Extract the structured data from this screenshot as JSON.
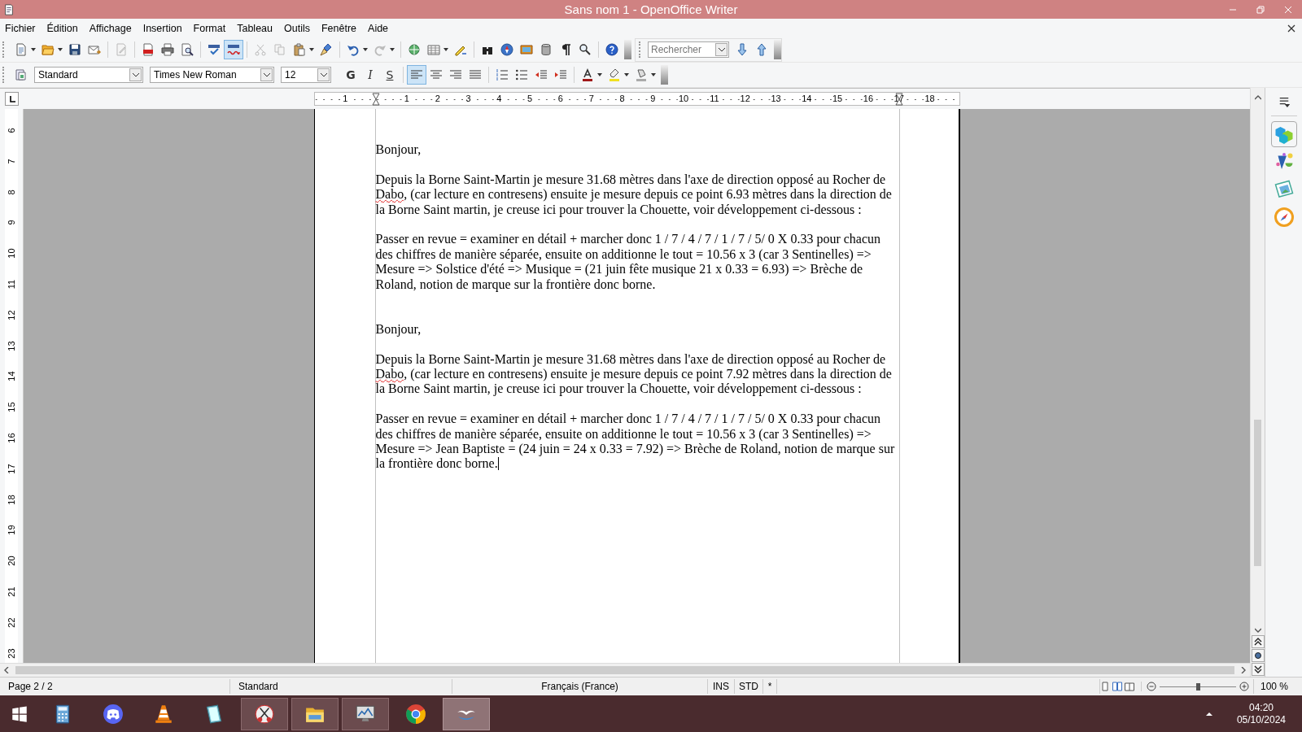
{
  "window": {
    "title": "Sans nom 1 - OpenOffice Writer"
  },
  "menu": [
    {
      "label": "Fichier"
    },
    {
      "label": "Édition"
    },
    {
      "label": "Affichage"
    },
    {
      "label": "Insertion"
    },
    {
      "label": "Format"
    },
    {
      "label": "Tableau"
    },
    {
      "label": "Outils"
    },
    {
      "label": "Fenêtre"
    },
    {
      "label": "Aide"
    }
  ],
  "standard_toolbar": {
    "autospell": {
      "on": true
    },
    "search": {
      "placeholder": "Rechercher"
    }
  },
  "formatting_toolbar": {
    "paragraph_style": "Standard",
    "font_name": "Times New Roman",
    "font_size": "12",
    "text_style_buttons": [
      "G",
      "I",
      "S"
    ],
    "alignment": [
      {
        "selected": true
      },
      {
        "selected": false
      },
      {
        "selected": false
      },
      {
        "selected": false
      }
    ]
  },
  "ruler": {
    "negative_labels": [
      "1"
    ],
    "labels": [
      "1",
      "2",
      "3",
      "4",
      "5",
      "6",
      "7",
      "8",
      "9",
      "10",
      "11",
      "12",
      "13",
      "14",
      "15",
      "16",
      "17",
      "18"
    ],
    "vertical_labels": [
      "6",
      "7",
      "8",
      "9",
      "10",
      "11",
      "12",
      "13",
      "14",
      "15",
      "16",
      "17",
      "18",
      "19",
      "20",
      "21",
      "22",
      "23"
    ]
  },
  "document": {
    "paragraphs": [
      {
        "kind": "text",
        "segments": [
          {
            "text": "Bonjour,",
            "misspelled": false
          }
        ]
      },
      {
        "kind": "blank"
      },
      {
        "kind": "text",
        "segments": [
          {
            "text": "Depuis la Borne Saint-Martin je mesure 31.68 mètres dans l'axe de direction opposé au Rocher de ",
            "misspelled": false
          },
          {
            "text": "Dabo",
            "misspelled": true
          },
          {
            "text": ", (car lecture en contresens) ensuite je mesure depuis ce point 6.93 mètres dans la direction de la Borne Saint martin, je creuse ici pour trouver la Chouette, voir développement ci-dessous :",
            "misspelled": false
          }
        ]
      },
      {
        "kind": "blank"
      },
      {
        "kind": "text",
        "segments": [
          {
            "text": "Passer en revue = examiner en détail + marcher donc 1 / 7 / 4 / 7 / 1 / 7 / 5/ 0 X 0.33 pour chacun des chiffres de manière séparée, ensuite on additionne le tout = 10.56 x 3 (car 3 Sentinelles) => Mesure => Solstice d'été => Musique = (21 juin fête musique 21 x 0.33 = 6.93) => Brèche de Roland, notion de marque sur la frontière donc borne.",
            "misspelled": false
          }
        ]
      },
      {
        "kind": "blank"
      },
      {
        "kind": "blank"
      },
      {
        "kind": "text",
        "segments": [
          {
            "text": "Bonjour,",
            "misspelled": false
          }
        ]
      },
      {
        "kind": "blank"
      },
      {
        "kind": "text",
        "segments": [
          {
            "text": "Depuis la Borne Saint-Martin je mesure 31.68 mètres dans l'axe de direction opposé au Rocher de ",
            "misspelled": false
          },
          {
            "text": "Dabo",
            "misspelled": true
          },
          {
            "text": ", (car lecture en contresens) ensuite je mesure depuis ce point 7.92 mètres dans la direction de la Borne Saint martin, je creuse ici pour trouver la Chouette, voir développement ci-dessous :",
            "misspelled": false
          }
        ]
      },
      {
        "kind": "blank"
      },
      {
        "kind": "text",
        "cursor": true,
        "segments": [
          {
            "text": "Passer en revue = examiner en détail + marcher donc 1 / 7 / 4 / 7 / 1 / 7 / 5/ 0 X 0.33 pour chacun des chiffres de manière séparée, ensuite on additionne le tout = 10.56 x 3 (car 3 Sentinelles) => Mesure => Jean Baptiste = (24 juin = 24 x 0.33 = 7.92) => Brèche de Roland, notion de marque sur la frontière donc borne.",
            "misspelled": false
          }
        ]
      }
    ]
  },
  "status_bar": {
    "page": "Page 2 / 2",
    "style": "Standard",
    "language": "Français (France)",
    "insert_mode": "INS",
    "selection_mode": "STD",
    "modified": "*",
    "zoom_slider": {
      "level": 0.5
    },
    "zoom": "100 %"
  },
  "taskbar": {
    "apps": [
      {
        "running": false,
        "selected": false
      },
      {
        "running": false,
        "selected": false
      },
      {
        "running": false,
        "selected": false
      },
      {
        "running": false,
        "selected": false
      },
      {
        "running": true,
        "selected": false
      },
      {
        "running": true,
        "selected": false
      },
      {
        "running": true,
        "selected": false
      },
      {
        "running": false,
        "selected": false
      },
      {
        "running": true,
        "selected": true
      }
    ],
    "time": "04:20",
    "date": "05/10/2024"
  }
}
